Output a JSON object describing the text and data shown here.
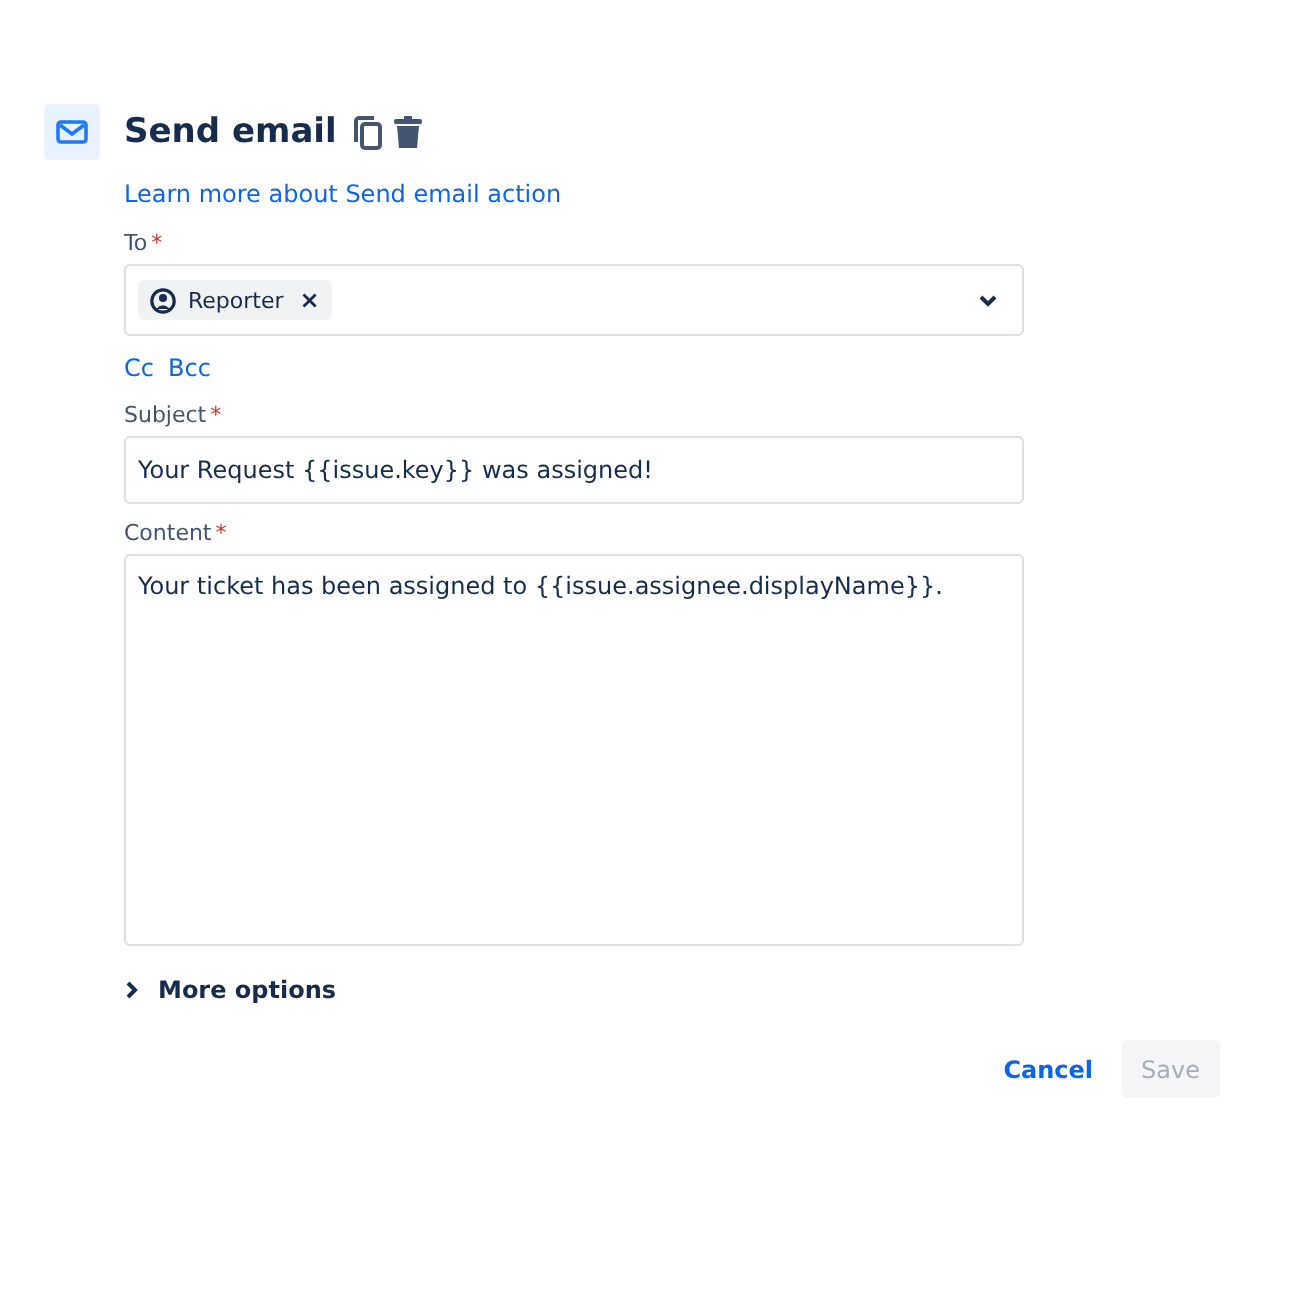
{
  "header": {
    "title": "Send email"
  },
  "learn_link": "Learn more about Send email action",
  "to": {
    "label": "To",
    "required_mark": "*",
    "chips": [
      {
        "label": "Reporter",
        "remove": "×"
      }
    ]
  },
  "cc_links": [
    "Cc",
    "Bcc"
  ],
  "subject": {
    "label": "Subject",
    "required_mark": "*",
    "value": "Your Request {{issue.key}} was assigned!"
  },
  "content": {
    "label": "Content",
    "required_mark": "*",
    "value": "Your ticket has been assigned to {{issue.assignee.displayName}}."
  },
  "more_options": {
    "label": "More options",
    "expanded": false
  },
  "buttons": [
    {
      "label": "Cancel",
      "kind": "link",
      "disabled": false
    },
    {
      "label": "Save",
      "kind": "primary",
      "disabled": true
    }
  ]
}
